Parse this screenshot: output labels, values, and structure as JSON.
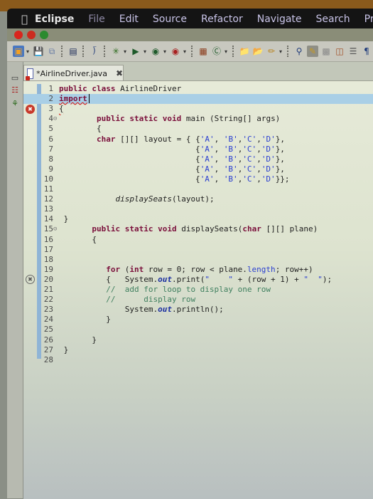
{
  "menubar": {
    "apple_icon": "apple-logo",
    "app_name": "Eclipse",
    "items": [
      "File",
      "Edit",
      "Source",
      "Refactor",
      "Navigate",
      "Search",
      "Project"
    ]
  },
  "window": {
    "traffic_lights": [
      "close",
      "minimize",
      "zoom"
    ]
  },
  "toolbar": {
    "icons": [
      "new-icon",
      "save-icon",
      "save-all-icon",
      "console-icon",
      "skip-breakpoints-icon",
      "debug-icon",
      "run-icon",
      "coverage-icon",
      "external-tools-icon",
      "new-java-package-icon",
      "new-java-class-icon",
      "open-type-icon",
      "open-task-icon",
      "search-icon",
      "next-annotation-icon",
      "toggle-mark-occurrences-icon",
      "toggle-breadcrumb-icon",
      "open-declaration-icon",
      "show-whitespace-icon",
      "show-paragraph-icon"
    ]
  },
  "editor": {
    "tab": {
      "title": "*AirlineDriver.java",
      "close_icon": "close-icon"
    },
    "lines": [
      {
        "n": "1",
        "text": "public class AirlineDriver"
      },
      {
        "n": "2",
        "text": "import ",
        "error": true,
        "current": true
      },
      {
        "n": "3",
        "text": "{",
        "error": true
      },
      {
        "n": "4",
        "text": "        public static void main (String[] args)",
        "fold": true
      },
      {
        "n": "5",
        "text": "        {"
      },
      {
        "n": "6",
        "text": "        char [][] layout = { {'A', 'B','C','D'},"
      },
      {
        "n": "7",
        "text": "                             {'A', 'B','C','D'},"
      },
      {
        "n": "8",
        "text": "                             {'A', 'B','C','D'},"
      },
      {
        "n": "9",
        "text": "                             {'A', 'B','C','D'},"
      },
      {
        "n": "10",
        "text": "                             {'A', 'B','C','D'}};"
      },
      {
        "n": "11",
        "text": ""
      },
      {
        "n": "12",
        "text": "            displaySeats(layout);"
      },
      {
        "n": "13",
        "text": ""
      },
      {
        "n": "14",
        "text": " }"
      },
      {
        "n": "15",
        "text": "       public static void displaySeats(char [][] plane)",
        "fold": true
      },
      {
        "n": "16",
        "text": "       {"
      },
      {
        "n": "17",
        "text": ""
      },
      {
        "n": "18",
        "text": ""
      },
      {
        "n": "19",
        "text": "          for (int row = 0; row < plane.length; row++)"
      },
      {
        "n": "20",
        "text": "          {   System.out.print(\"    \" + (row + 1) + \"  \");",
        "warning": true
      },
      {
        "n": "21",
        "text": "          //  add for loop to display one row"
      },
      {
        "n": "22",
        "text": "          //      display row"
      },
      {
        "n": "23",
        "text": "              System.out.println();"
      },
      {
        "n": "24",
        "text": "          }"
      },
      {
        "n": "25",
        "text": ""
      },
      {
        "n": "26",
        "text": "       }"
      },
      {
        "n": "27",
        "text": " }"
      },
      {
        "n": "28",
        "text": ""
      }
    ]
  },
  "colors": {
    "keyword": "#7a0e3a",
    "string": "#2a3fd0",
    "comment": "#3f7f5f",
    "error": "#d6231c",
    "current_line": "#a9cfe6"
  }
}
